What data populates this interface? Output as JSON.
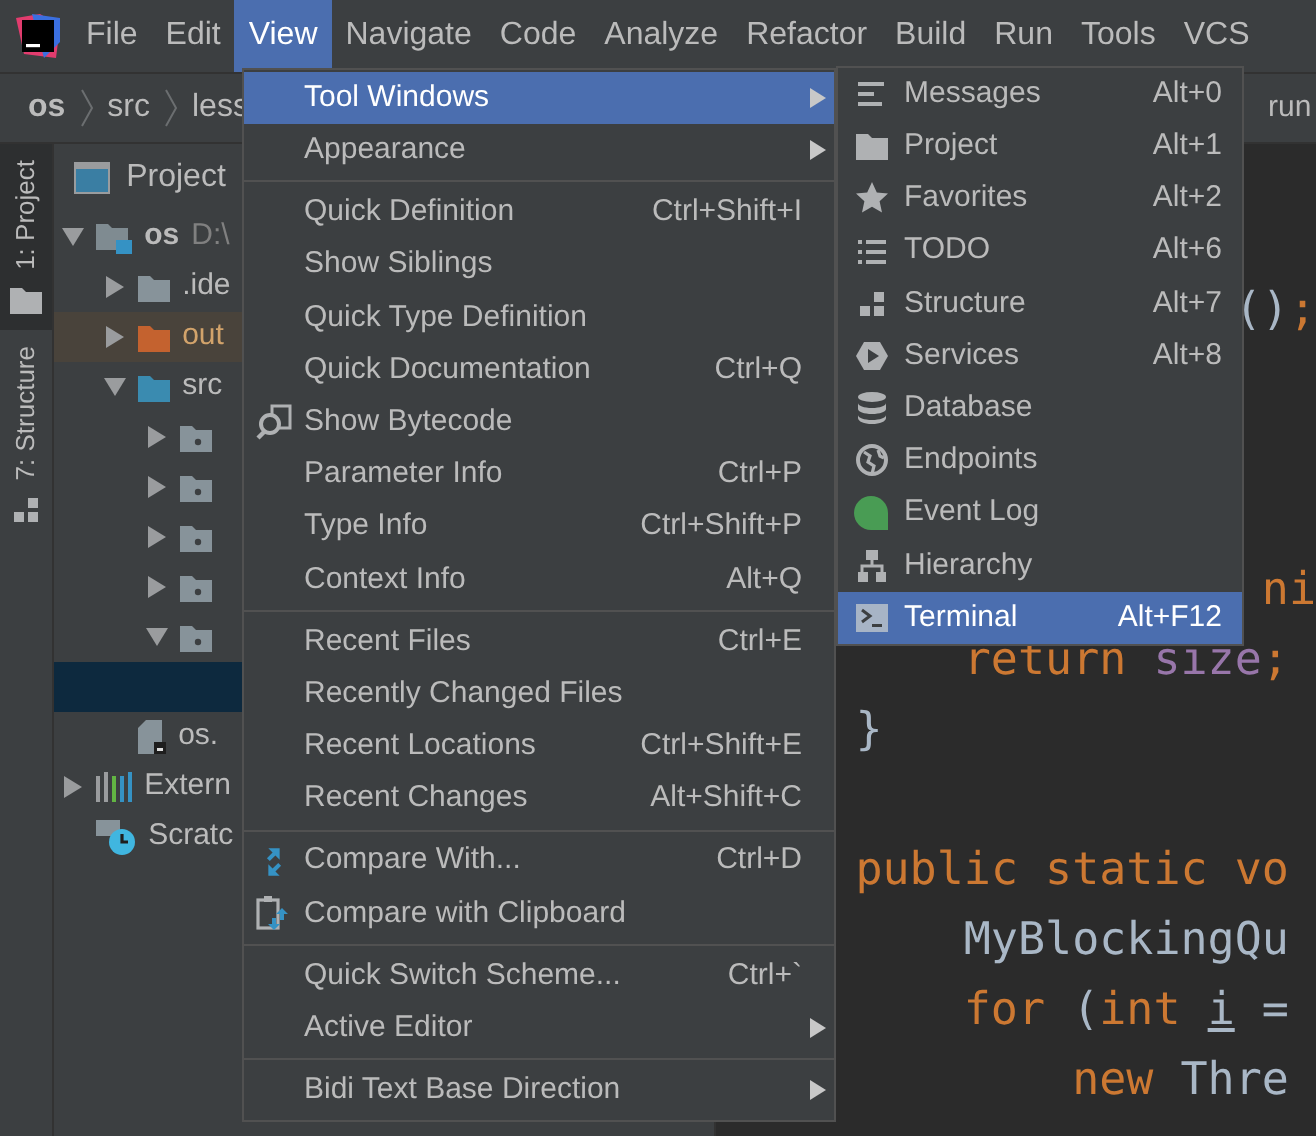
{
  "menubar": [
    {
      "label": "File",
      "selected": false
    },
    {
      "label": "Edit",
      "selected": false
    },
    {
      "label": "View",
      "selected": true
    },
    {
      "label": "Navigate",
      "selected": false
    },
    {
      "label": "Code",
      "selected": false
    },
    {
      "label": "Analyze",
      "selected": false
    },
    {
      "label": "Refactor",
      "selected": false
    },
    {
      "label": "Build",
      "selected": false
    },
    {
      "label": "Run",
      "selected": false
    },
    {
      "label": "Tools",
      "selected": false
    },
    {
      "label": "VCS",
      "selected": false
    }
  ],
  "breadcrumbs": [
    "os",
    "src",
    "less"
  ],
  "editor_tab": "run",
  "tool_strip": [
    {
      "label": "1: Project",
      "selected": true
    },
    {
      "label": "7: Structure",
      "selected": false
    }
  ],
  "project_panel": {
    "title": "Project",
    "tree": [
      {
        "kind": "module",
        "label": "os",
        "path": "D:\\",
        "expanded": true,
        "selected": false,
        "children": [
          {
            "kind": "folder",
            "label": ".ide",
            "expanded": false,
            "selected": false
          },
          {
            "kind": "excluded_folder",
            "label": "out",
            "expanded": false,
            "selected": false
          },
          {
            "kind": "source_folder",
            "label": "src",
            "expanded": true,
            "selected": false,
            "children": [
              {
                "kind": "package",
                "expanded": false,
                "selected": false
              },
              {
                "kind": "package",
                "expanded": false,
                "selected": false
              },
              {
                "kind": "package",
                "expanded": false,
                "selected": false
              },
              {
                "kind": "package",
                "expanded": false,
                "selected": false
              },
              {
                "kind": "package",
                "expanded": true,
                "selected": false,
                "children": [
                  {
                    "selected": true
                  }
                ]
              }
            ]
          },
          {
            "kind": "file",
            "label": "os.",
            "selected": false
          }
        ]
      },
      {
        "kind": "library",
        "label": "Extern",
        "expanded": false,
        "selected": false
      },
      {
        "kind": "scratch",
        "label": "Scratc",
        "selected": false
      }
    ]
  },
  "editor": {
    "lines": [
      {
        "kind": "code",
        "tokens": [
          {
            "text": "              ()",
            "kind": "plain"
          },
          {
            "text": ";",
            "kind": "keyword"
          }
        ]
      },
      {
        "kind": "blank"
      },
      {
        "kind": "blank"
      },
      {
        "kind": "blank"
      },
      {
        "kind": "code",
        "tokens": [
          {
            "text": "               ni",
            "kind": "keyword"
          }
        ]
      },
      {
        "kind": "code",
        "tokens": [
          {
            "text": "    return ",
            "kind": "keyword"
          },
          {
            "text": "size",
            "kind": "field"
          },
          {
            "text": ";",
            "kind": "keyword"
          }
        ]
      },
      {
        "kind": "code",
        "tokens": [
          {
            "text": "}",
            "kind": "plain"
          }
        ]
      },
      {
        "kind": "blank"
      },
      {
        "kind": "code",
        "tokens": [
          {
            "text": "public static vo",
            "kind": "keyword"
          }
        ]
      },
      {
        "kind": "code",
        "tokens": [
          {
            "text": "    MyBlockingQu",
            "kind": "plain"
          }
        ]
      },
      {
        "kind": "code",
        "tokens": [
          {
            "text": "    for ",
            "kind": "keyword"
          },
          {
            "text": "(",
            "kind": "plain"
          },
          {
            "text": "int ",
            "kind": "keyword"
          },
          {
            "text": "i",
            "kind": "local"
          },
          {
            "text": " =",
            "kind": "plain"
          }
        ]
      },
      {
        "kind": "code",
        "tokens": [
          {
            "text": "        new ",
            "kind": "keyword"
          },
          {
            "text": "Thre",
            "kind": "plain"
          }
        ]
      }
    ]
  },
  "view_menu": {
    "items": [
      {
        "kind": "item",
        "label": "Tool Windows",
        "submenu": true,
        "selected": true
      },
      {
        "kind": "item",
        "label": "Appearance",
        "submenu": true,
        "selected": false
      },
      {
        "kind": "separator"
      },
      {
        "kind": "item",
        "label": "Quick Definition",
        "shortcut": "Ctrl+Shift+I",
        "submenu": false,
        "selected": false
      },
      {
        "kind": "item",
        "label": "Show Siblings",
        "submenu": false,
        "selected": false
      },
      {
        "kind": "item",
        "label": "Quick Type Definition",
        "submenu": false,
        "selected": false
      },
      {
        "kind": "item",
        "label": "Quick Documentation",
        "shortcut": "Ctrl+Q",
        "submenu": false,
        "selected": false
      },
      {
        "kind": "item",
        "label": "Show Bytecode",
        "submenu": false,
        "selected": false
      },
      {
        "kind": "item",
        "label": "Parameter Info",
        "shortcut": "Ctrl+P",
        "submenu": false,
        "selected": false
      },
      {
        "kind": "item",
        "label": "Type Info",
        "shortcut": "Ctrl+Shift+P",
        "submenu": false,
        "selected": false
      },
      {
        "kind": "item",
        "label": "Context Info",
        "shortcut": "Alt+Q",
        "submenu": false,
        "selected": false
      },
      {
        "kind": "separator"
      },
      {
        "kind": "item",
        "label": "Recent Files",
        "shortcut": "Ctrl+E",
        "submenu": false,
        "selected": false
      },
      {
        "kind": "item",
        "label": "Recently Changed Files",
        "submenu": false,
        "selected": false
      },
      {
        "kind": "item",
        "label": "Recent Locations",
        "shortcut": "Ctrl+Shift+E",
        "submenu": false,
        "selected": false
      },
      {
        "kind": "item",
        "label": "Recent Changes",
        "shortcut": "Alt+Shift+C",
        "submenu": false,
        "selected": false
      },
      {
        "kind": "separator"
      },
      {
        "kind": "item",
        "label": "Compare With...",
        "shortcut": "Ctrl+D",
        "submenu": false,
        "selected": false
      },
      {
        "kind": "item",
        "label": "Compare with Clipboard",
        "submenu": false,
        "selected": false
      },
      {
        "kind": "separator"
      },
      {
        "kind": "item",
        "label": "Quick Switch Scheme...",
        "shortcut": "Ctrl+`",
        "submenu": false,
        "selected": false
      },
      {
        "kind": "item",
        "label": "Active Editor",
        "submenu": true,
        "selected": false
      },
      {
        "kind": "separator"
      },
      {
        "kind": "item",
        "label": "Bidi Text Base Direction",
        "submenu": true,
        "selected": false
      }
    ]
  },
  "tool_windows_menu": {
    "items": [
      {
        "label": "Messages",
        "shortcut": "Alt+0",
        "selected": false
      },
      {
        "label": "Project",
        "shortcut": "Alt+1",
        "selected": false
      },
      {
        "label": "Favorites",
        "shortcut": "Alt+2",
        "selected": false
      },
      {
        "label": "TODO",
        "shortcut": "Alt+6",
        "selected": false
      },
      {
        "label": "Structure",
        "shortcut": "Alt+7",
        "selected": false
      },
      {
        "label": "Services",
        "shortcut": "Alt+8",
        "selected": false
      },
      {
        "label": "Database",
        "selected": false
      },
      {
        "label": "Endpoints",
        "selected": false
      },
      {
        "label": "Event Log",
        "selected": false
      },
      {
        "label": "Hierarchy",
        "selected": false
      },
      {
        "label": "Terminal",
        "shortcut": "Alt+F12",
        "selected": true
      }
    ]
  }
}
